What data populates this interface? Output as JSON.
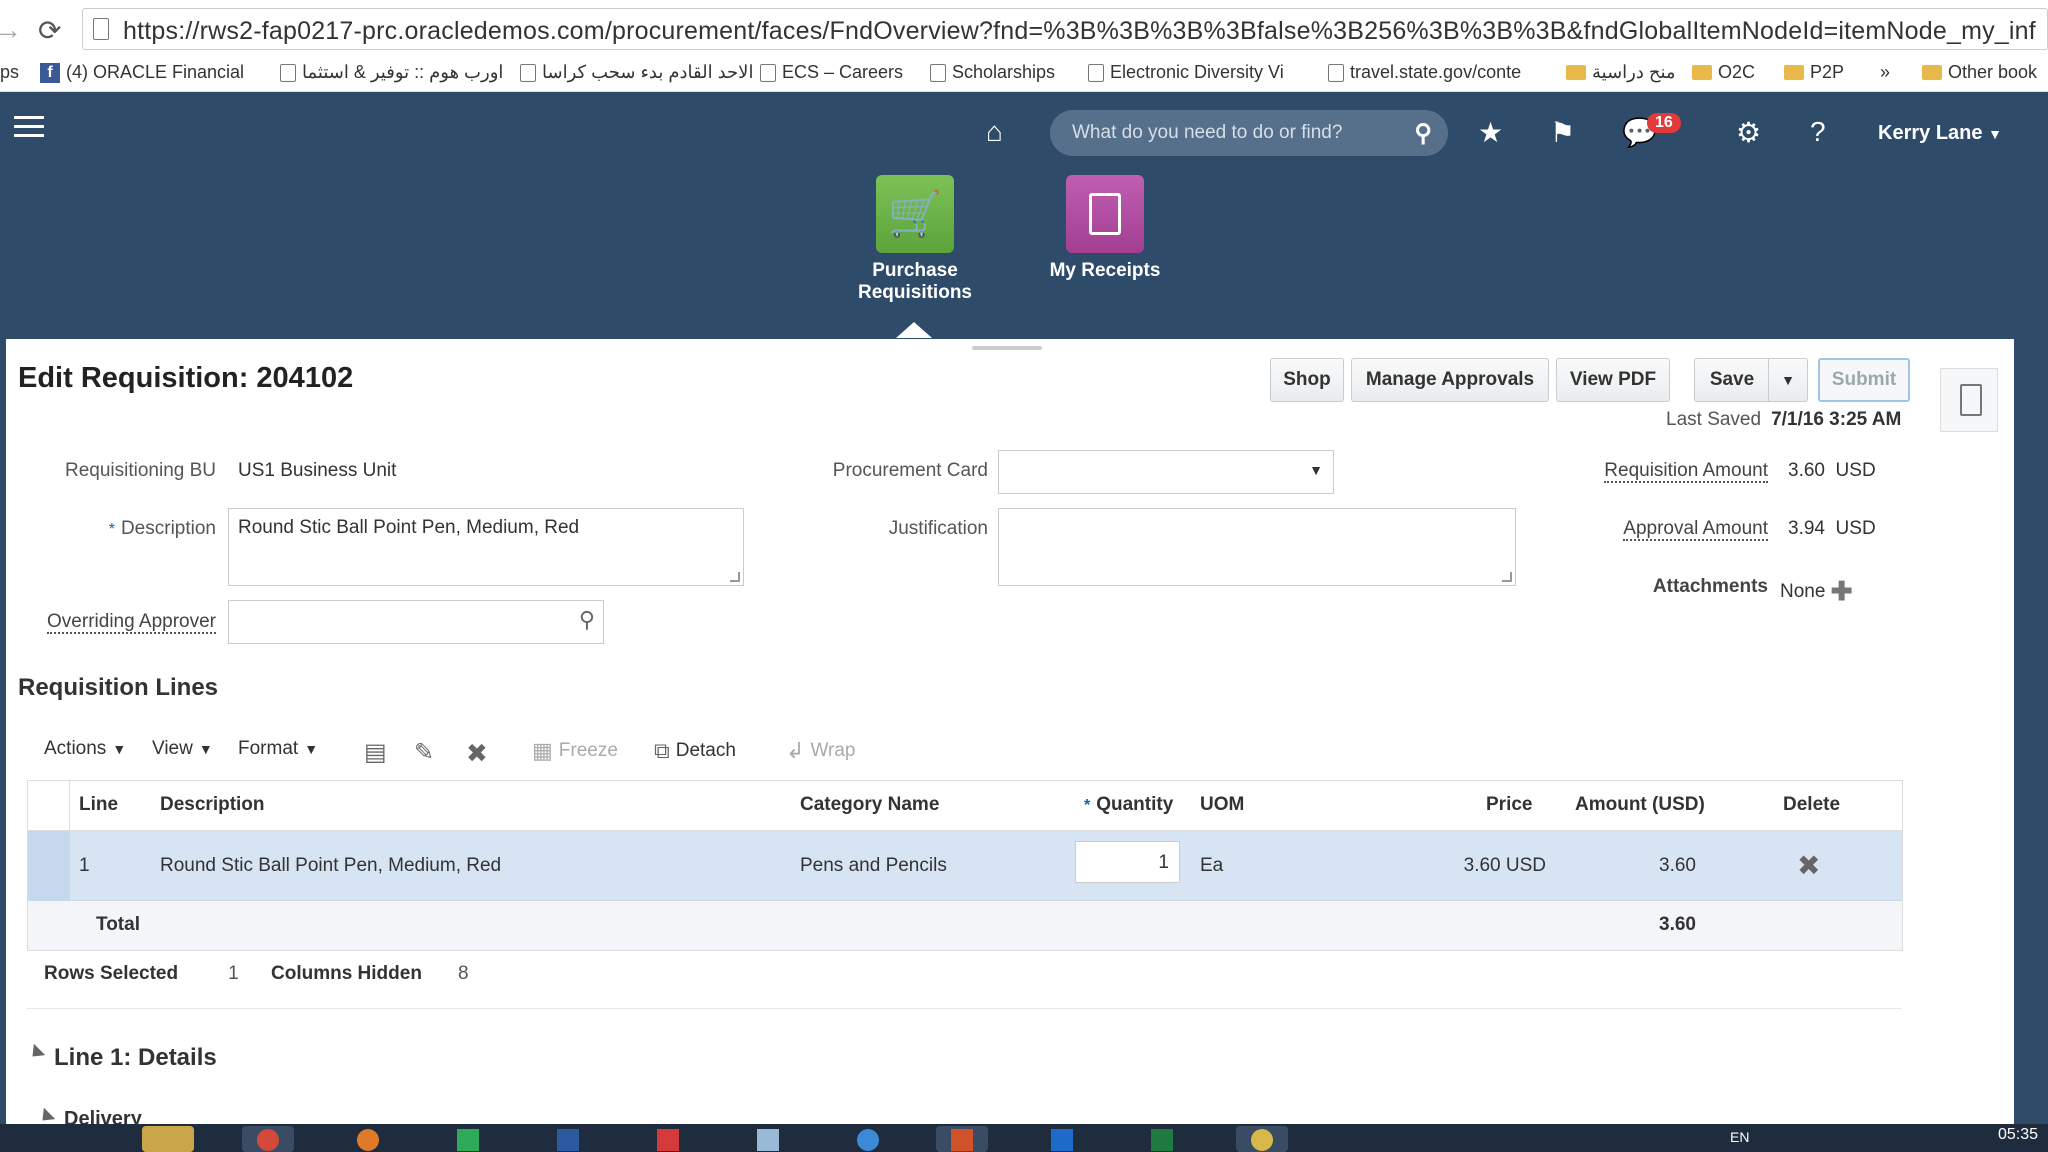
{
  "browser": {
    "url": "https://rws2-fap0217-prc.oraclede­mos.com/procurement/faces/FndOverview?fnd=%3B%3B%3B%3Bfalse%3B256%3B%3B%3B&fndGlobalItemNodeId=itemNode_my_inf",
    "bookmarks": [
      "ps",
      "(4) ORACLE Financial",
      "اورب هوم :: توفير & استثما",
      "الاحد القادم بدء سحب كراسا",
      "ECS – Careers",
      "Scholarships",
      "Electronic Diversity Vi",
      "travel.state.gov/conte",
      "منح دراسية",
      "O2C",
      "P2P",
      "»",
      "Other book"
    ]
  },
  "header": {
    "search_placeholder": "What do you need to do or find?",
    "notification_count": "16",
    "user_name": "Kerry Lane"
  },
  "tiles": {
    "purchase_requisitions": "Purchase Requisitions",
    "my_receipts": "My Receipts"
  },
  "page": {
    "title": "Edit Requisition: 204102",
    "buttons": {
      "shop": "Shop",
      "manage_approvals": "Manage Approvals",
      "view_pdf": "View PDF",
      "save": "Save",
      "submit": "Submit"
    },
    "last_saved_label": "Last Saved",
    "last_saved_value": "7/1/16 3:25 AM"
  },
  "form": {
    "requisitioning_bu_label": "Requisitioning BU",
    "requisitioning_bu_value": "US1 Business Unit",
    "description_label": "Description",
    "description_value": "Round Stic Ball Point Pen, Medium, Red",
    "overriding_approver_label": "Overriding Approver",
    "overriding_approver_value": "",
    "procurement_card_label": "Procurement Card",
    "procurement_card_value": "",
    "justification_label": "Justification",
    "justification_value": "",
    "requisition_amount_label": "Requisition Amount",
    "requisition_amount_value": "3.60",
    "requisition_amount_currency": "USD",
    "approval_amount_label": "Approval Amount",
    "approval_amount_value": "3.94",
    "approval_amount_currency": "USD",
    "attachments_label": "Attachments",
    "attachments_value": "None"
  },
  "lines": {
    "section_title": "Requisition Lines",
    "toolbar": {
      "actions": "Actions",
      "view": "View",
      "format": "Format",
      "freeze": "Freeze",
      "detach": "Detach",
      "wrap": "Wrap"
    },
    "columns": {
      "line": "Line",
      "description": "Description",
      "category": "Category Name",
      "quantity": "Quantity",
      "uom": "UOM",
      "price": "Price",
      "amount": "Amount (USD)",
      "delete": "Delete"
    },
    "rows": [
      {
        "line": "1",
        "description": "Round Stic Ball Point Pen, Medium, Red",
        "category": "Pens and Pencils",
        "quantity": "1",
        "uom": "Ea",
        "price": "3.60 USD",
        "amount": "3.60"
      }
    ],
    "total_label": "Total",
    "total_value": "3.60",
    "rows_selected_label": "Rows Selected",
    "rows_selected_value": "1",
    "columns_hidden_label": "Columns Hidden",
    "columns_hidden_value": "8"
  },
  "details": {
    "title": "Line 1: Details",
    "subsection": "Delivery"
  },
  "taskbar": {
    "clock": "05:35",
    "lang": "EN"
  },
  "colors": {
    "app_header": "#2e4b6a",
    "selected_row": "#d6e4f3",
    "purchase_tile": "#6db24a",
    "receipts_tile": "#b34fa3",
    "badge": "#e03a3a"
  }
}
